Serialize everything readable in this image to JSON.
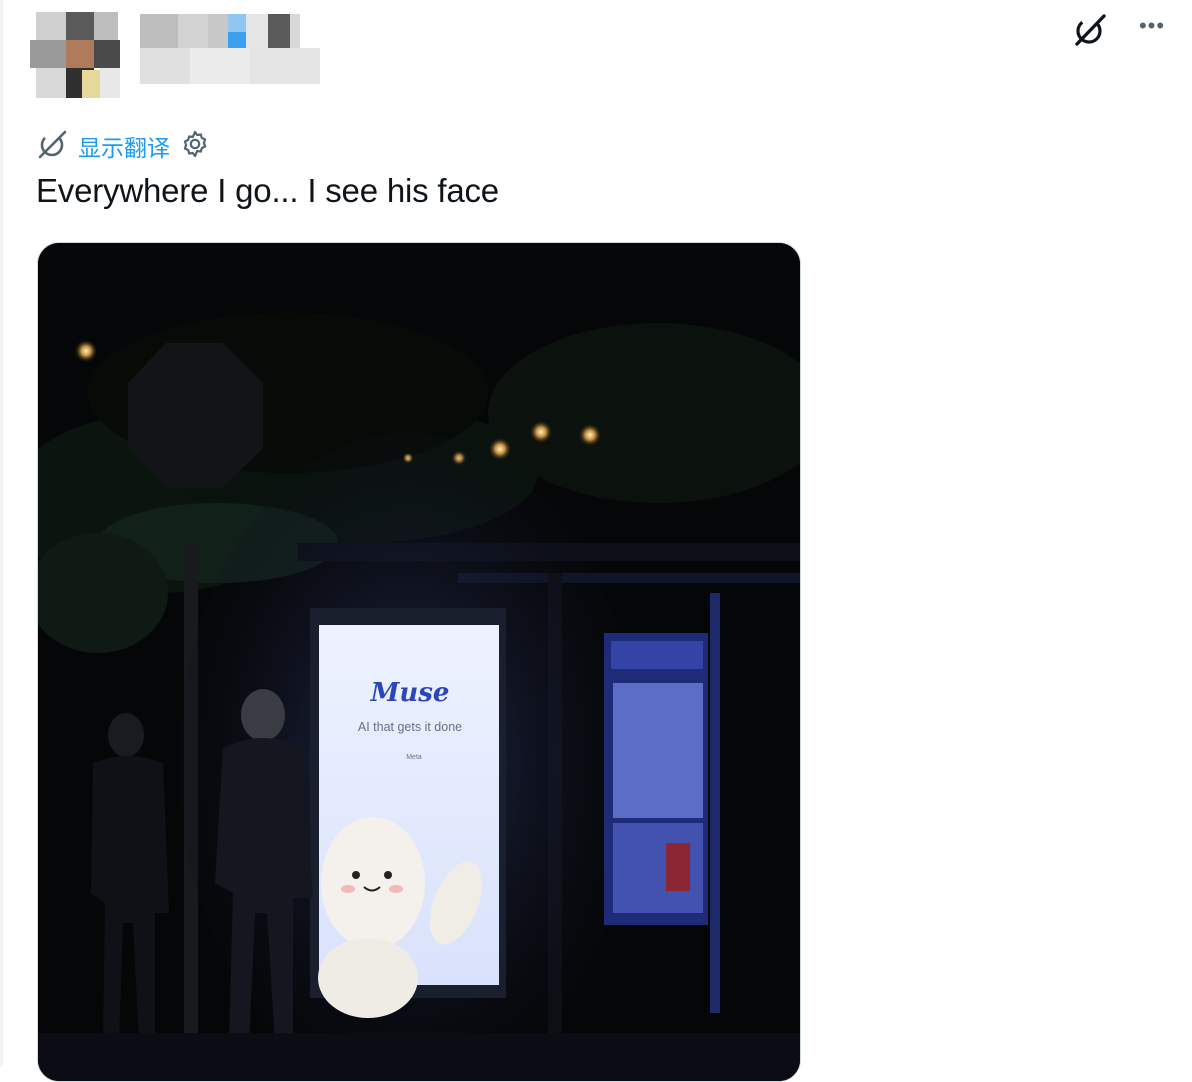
{
  "tweet": {
    "translate_label": "显示翻译",
    "text": "Everywhere I go... I see his face"
  },
  "actions": {
    "more_label": "•••"
  },
  "photo": {
    "ad_brand": "Muse",
    "ad_tagline": "AI that gets it done",
    "ad_sponsor": "Meta"
  },
  "colors": {
    "accent": "#1d9bf0",
    "text": "#0f1419",
    "muted": "#536471"
  },
  "icons": [
    "grok-icon",
    "more-icon",
    "translate-icon",
    "settings-gear-icon"
  ]
}
